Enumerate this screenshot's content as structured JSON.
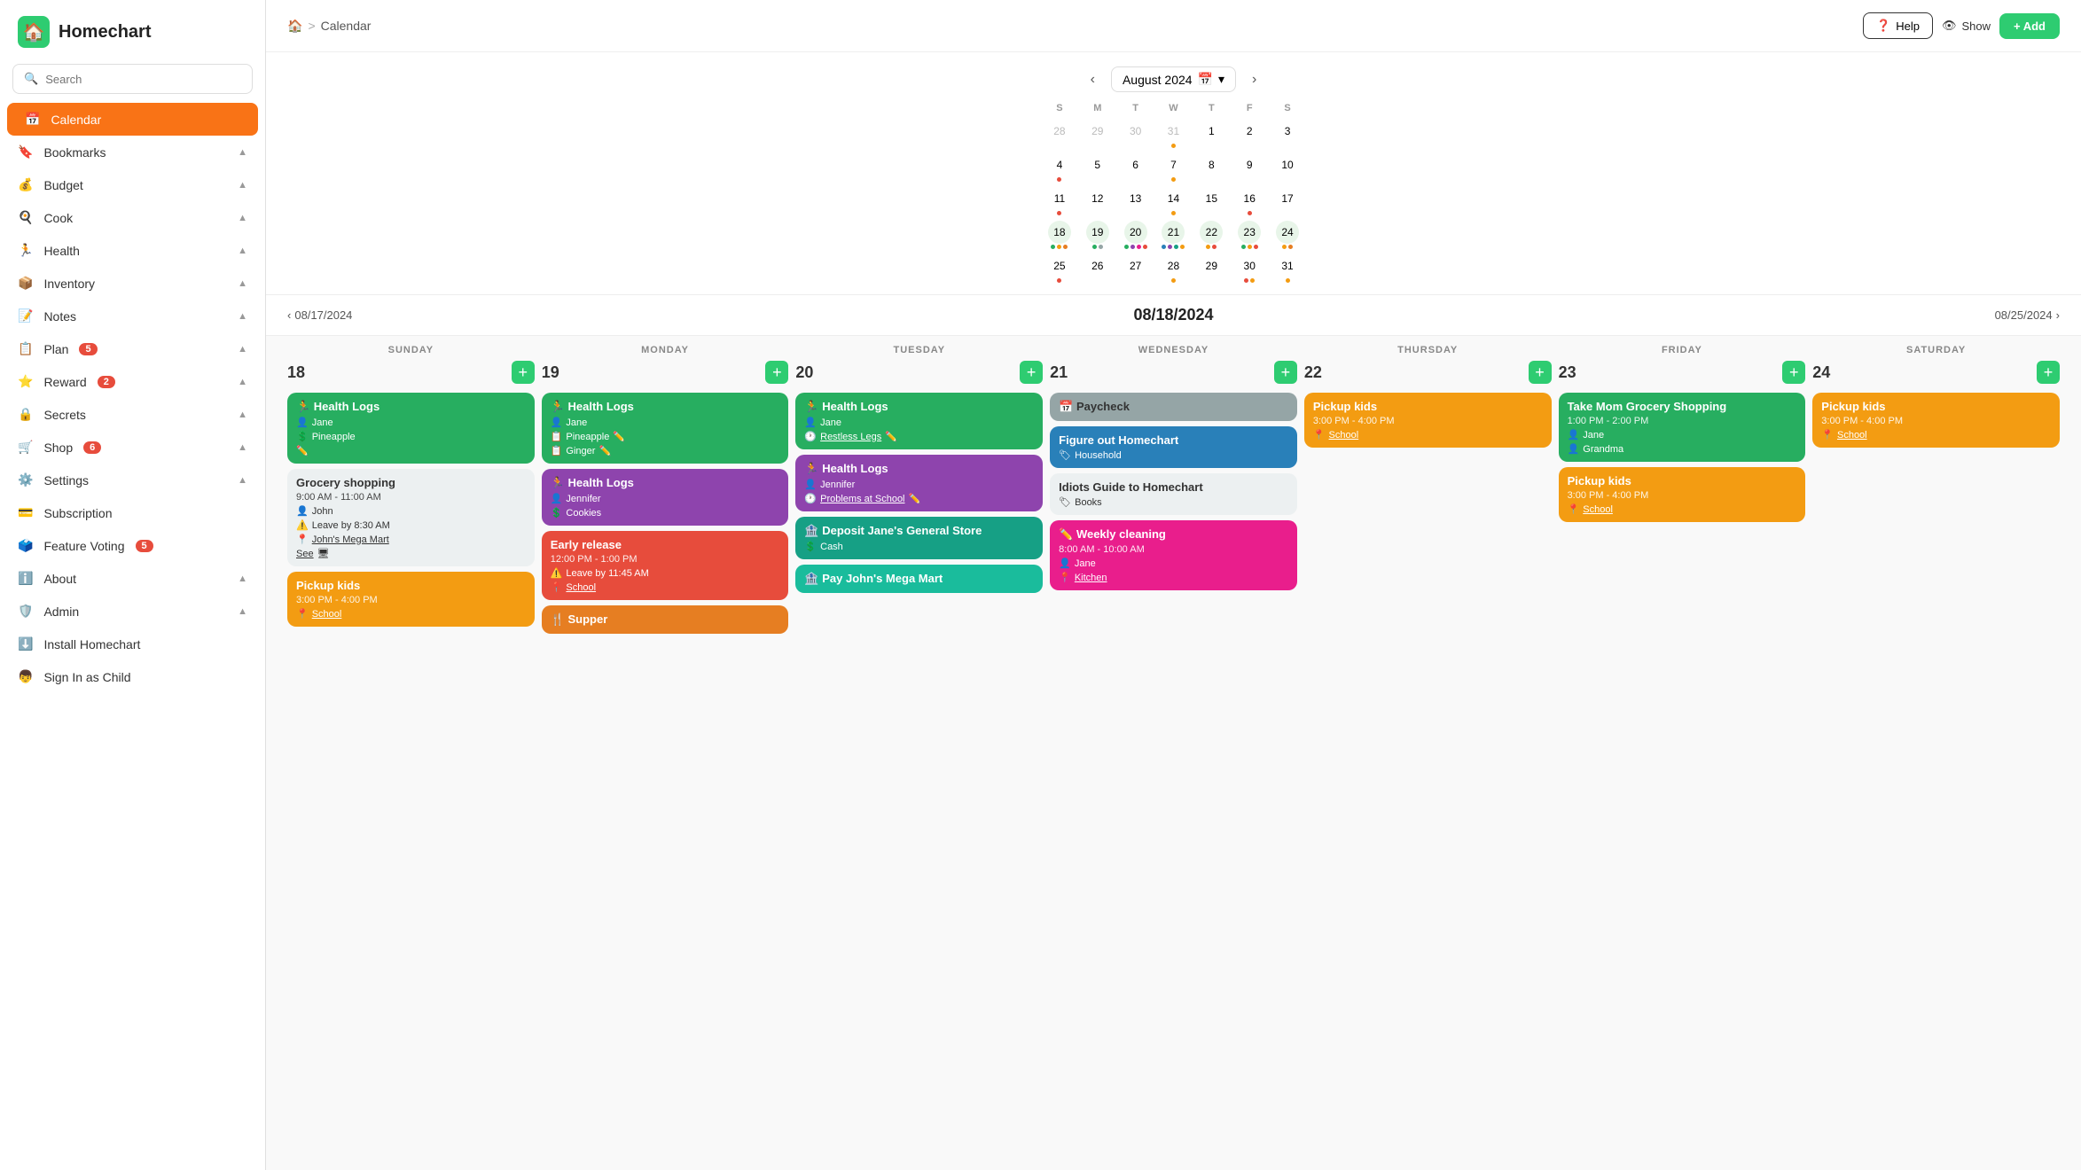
{
  "app": {
    "name": "Homechart",
    "logo_icon": "🏠"
  },
  "search": {
    "placeholder": "Search"
  },
  "nav": {
    "items": [
      {
        "id": "calendar",
        "label": "Calendar",
        "icon": "📅",
        "active": true
      },
      {
        "id": "bookmarks",
        "label": "Bookmarks",
        "icon": "🔖",
        "chevron": "▲"
      },
      {
        "id": "budget",
        "label": "Budget",
        "icon": "💰",
        "chevron": "▲"
      },
      {
        "id": "cook",
        "label": "Cook",
        "icon": "🍳",
        "chevron": "▲"
      },
      {
        "id": "health",
        "label": "Health",
        "icon": "🏃",
        "chevron": "▲"
      },
      {
        "id": "inventory",
        "label": "Inventory",
        "icon": "📦",
        "chevron": "▲"
      },
      {
        "id": "notes",
        "label": "Notes",
        "icon": "📝",
        "chevron": "▲"
      },
      {
        "id": "plan",
        "label": "Plan",
        "icon": "📋",
        "badge": "5",
        "chevron": "▲"
      },
      {
        "id": "reward",
        "label": "Reward",
        "icon": "⭐",
        "badge": "2",
        "chevron": "▲"
      },
      {
        "id": "secrets",
        "label": "Secrets",
        "icon": "🔒",
        "chevron": "▲"
      },
      {
        "id": "shop",
        "label": "Shop",
        "icon": "🛒",
        "badge": "6",
        "chevron": "▲"
      },
      {
        "id": "settings",
        "label": "Settings",
        "icon": "⚙️",
        "chevron": "▲"
      },
      {
        "id": "subscription",
        "label": "Subscription",
        "icon": "💳"
      },
      {
        "id": "feature-voting",
        "label": "Feature Voting",
        "icon": "🗳️",
        "badge": "5"
      },
      {
        "id": "about",
        "label": "About",
        "icon": "ℹ️",
        "chevron": "▲"
      },
      {
        "id": "admin",
        "label": "Admin",
        "icon": "🛡️",
        "chevron": "▲"
      },
      {
        "id": "install",
        "label": "Install Homechart",
        "icon": "⬇️"
      },
      {
        "id": "sign-in-child",
        "label": "Sign In as Child",
        "icon": "👦"
      }
    ]
  },
  "header": {
    "breadcrumb_home": "🏠",
    "breadcrumb_sep": ">",
    "breadcrumb_page": "Calendar",
    "help_label": "Help",
    "show_label": "Show",
    "add_label": "+ Add"
  },
  "mini_cal": {
    "title": "August 2024",
    "days_header": [
      "S",
      "M",
      "T",
      "W",
      "T",
      "F",
      "S"
    ],
    "weeks": [
      [
        {
          "num": "28",
          "other": true,
          "dots": []
        },
        {
          "num": "29",
          "other": true,
          "dots": []
        },
        {
          "num": "30",
          "other": true,
          "dots": []
        },
        {
          "num": "31",
          "other": true,
          "dots": [
            {
              "color": "#f39c12"
            }
          ]
        },
        {
          "num": "1",
          "dots": []
        },
        {
          "num": "2",
          "dots": []
        },
        {
          "num": "3",
          "dots": []
        }
      ],
      [
        {
          "num": "4",
          "dots": [
            {
              "color": "#e74c3c"
            }
          ]
        },
        {
          "num": "5",
          "dots": []
        },
        {
          "num": "6",
          "dots": []
        },
        {
          "num": "7",
          "dots": [
            {
              "color": "#f39c12"
            }
          ]
        },
        {
          "num": "8",
          "dots": []
        },
        {
          "num": "9",
          "dots": []
        },
        {
          "num": "10",
          "dots": []
        }
      ],
      [
        {
          "num": "11",
          "dots": [
            {
              "color": "#e74c3c"
            }
          ]
        },
        {
          "num": "12",
          "dots": []
        },
        {
          "num": "13",
          "dots": []
        },
        {
          "num": "14",
          "dots": [
            {
              "color": "#f39c12"
            }
          ]
        },
        {
          "num": "15",
          "dots": []
        },
        {
          "num": "16",
          "dots": [
            {
              "color": "#e74c3c"
            }
          ]
        },
        {
          "num": "17",
          "dots": []
        }
      ],
      [
        {
          "num": "18",
          "dots": [
            {
              "color": "#27ae60"
            },
            {
              "color": "#f39c12"
            },
            {
              "color": "#e67e22"
            }
          ]
        },
        {
          "num": "19",
          "dots": [
            {
              "color": "#27ae60"
            },
            {
              "color": "#95a5a6"
            }
          ]
        },
        {
          "num": "20",
          "dots": [
            {
              "color": "#27ae60"
            },
            {
              "color": "#8e44ad"
            },
            {
              "color": "#e91e8c"
            },
            {
              "color": "#e74c3c"
            }
          ]
        },
        {
          "num": "21",
          "dots": [
            {
              "color": "#2980b9"
            },
            {
              "color": "#8e44ad"
            },
            {
              "color": "#16a085"
            },
            {
              "color": "#f39c12"
            }
          ]
        },
        {
          "num": "22",
          "dots": [
            {
              "color": "#f39c12"
            },
            {
              "color": "#e74c3c"
            }
          ]
        },
        {
          "num": "23",
          "dots": [
            {
              "color": "#27ae60"
            },
            {
              "color": "#f39c12"
            },
            {
              "color": "#e74c3c"
            }
          ]
        },
        {
          "num": "24",
          "dots": [
            {
              "color": "#f39c12"
            },
            {
              "color": "#e67e22"
            }
          ]
        }
      ],
      [
        {
          "num": "25",
          "dots": [
            {
              "color": "#e74c3c"
            }
          ]
        },
        {
          "num": "26",
          "dots": []
        },
        {
          "num": "27",
          "dots": []
        },
        {
          "num": "28",
          "dots": [
            {
              "color": "#f39c12"
            }
          ]
        },
        {
          "num": "29",
          "dots": []
        },
        {
          "num": "30",
          "dots": [
            {
              "color": "#e74c3c"
            },
            {
              "color": "#f39c12"
            }
          ]
        },
        {
          "num": "31",
          "dots": [
            {
              "color": "#f39c12"
            }
          ]
        }
      ]
    ]
  },
  "week_nav": {
    "prev_date": "08/17/2024",
    "current_date": "08/18/2024",
    "next_date": "08/25/2024"
  },
  "week_grid": {
    "headers": [
      "SUNDAY",
      "MONDAY",
      "TUESDAY",
      "WEDNESDAY",
      "THURSDAY",
      "FRIDAY",
      "SATURDAY"
    ],
    "days": [
      {
        "num": "18",
        "events": [
          {
            "id": "health-logs-jane-pineapple-sun",
            "color": "green",
            "title": "Health Logs",
            "icon": "🏃",
            "person": "Jane",
            "detail": "Pineapple",
            "edit": true
          },
          {
            "id": "grocery-shopping",
            "color": "light-gray",
            "title": "Grocery shopping",
            "time": "9:00 AM - 11:00 AM",
            "person": "John",
            "warning": "Leave by 8:30 AM",
            "location": "John's Mega Mart",
            "see": "See"
          },
          {
            "id": "pickup-kids-sun",
            "color": "yellow",
            "title": "Pickup kids",
            "time": "3:00 PM - 4:00 PM",
            "location": "School"
          }
        ]
      },
      {
        "num": "19",
        "events": [
          {
            "id": "health-logs-jane-pineapple-ginger",
            "color": "green",
            "title": "Health Logs",
            "icon": "🏃",
            "person": "Jane",
            "detail1": "Pineapple",
            "detail2": "Ginger"
          },
          {
            "id": "health-logs-jennifer-cookies-mon",
            "color": "purple",
            "title": "Health Logs",
            "icon": "🏃",
            "person": "Jennifer",
            "detail": "Cookies"
          },
          {
            "id": "early-release",
            "color": "red-orange",
            "title": "Early release",
            "time": "12:00 PM - 1:00 PM",
            "warning": "Leave by 11:45 AM",
            "location": "School"
          },
          {
            "id": "supper-mon",
            "color": "orange",
            "title": "Supper",
            "icon": "🍴"
          }
        ]
      },
      {
        "num": "20",
        "events": [
          {
            "id": "health-logs-jane-restless",
            "color": "green",
            "title": "Health Logs",
            "icon": "🏃",
            "person": "Jane",
            "detail": "Restless Legs",
            "detail_link": true
          },
          {
            "id": "health-logs-jennifer-problems",
            "color": "purple",
            "title": "Health Logs",
            "icon": "🏃",
            "person": "Jennifer",
            "detail": "Problems at School",
            "detail_link": true
          },
          {
            "id": "deposit-jane-general",
            "color": "teal",
            "title": "Deposit Jane's General Store",
            "icon": "🏦",
            "detail": "Cash"
          },
          {
            "id": "pay-john-mega",
            "color": "dark-teal",
            "title": "Pay John's Mega Mart",
            "icon": "🏦"
          }
        ]
      },
      {
        "num": "21",
        "events": [
          {
            "id": "paycheck",
            "color": "gray",
            "title": "Paycheck",
            "icon": "📅"
          },
          {
            "id": "figure-out-homechart",
            "color": "blue",
            "title": "Figure out Homechart",
            "category": "Household"
          },
          {
            "id": "idiots-guide",
            "color": "light-gray",
            "title": "Idiots Guide to Homechart",
            "category": "Books"
          },
          {
            "id": "weekly-cleaning",
            "color": "pink",
            "title": "Weekly cleaning",
            "time": "8:00 AM - 10:00 AM",
            "person": "Jane",
            "location": "Kitchen",
            "icon": "✏️"
          }
        ]
      },
      {
        "num": "22",
        "events": [
          {
            "id": "pickup-kids-thu",
            "color": "yellow",
            "title": "Pickup kids",
            "time": "3:00 PM - 4:00 PM",
            "location": "School"
          }
        ]
      },
      {
        "num": "23",
        "events": [
          {
            "id": "take-mom-grocery",
            "color": "green",
            "title": "Take Mom Grocery Shopping",
            "time": "1:00 PM - 2:00 PM",
            "person": "Jane",
            "person2": "Grandma"
          },
          {
            "id": "pickup-kids-fri",
            "color": "yellow",
            "title": "Pickup kids",
            "time": "3:00 PM - 4:00 PM",
            "location": "School"
          }
        ]
      },
      {
        "num": "24",
        "events": [
          {
            "id": "pickup-kids-sat",
            "color": "yellow",
            "title": "Pickup kids",
            "time": "3:00 PM - 4:00 PM",
            "location": "School"
          }
        ]
      }
    ]
  }
}
